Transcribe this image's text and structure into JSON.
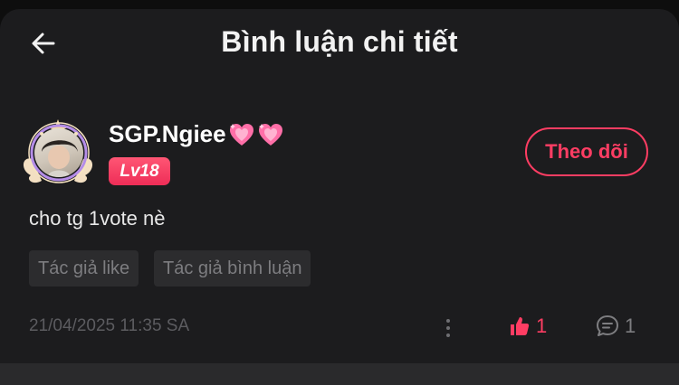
{
  "header": {
    "title": "Bình luận chi tiết",
    "back_icon": "arrow-left-icon"
  },
  "comment": {
    "user": {
      "name": "SGP.Ngiee",
      "name_suffix_icons": [
        "sparkling-heart-icon",
        "sparkling-heart-icon"
      ],
      "level": "Lv18",
      "avatar_icon": "avatar-with-winged-frame"
    },
    "follow_label": "Theo dõi",
    "text": "cho tg 1vote nè",
    "tags": [
      "Tác giả like",
      "Tác giả bình luận"
    ],
    "timestamp": "21/04/2025 11:35 SA",
    "likes": "1",
    "replies": "1"
  },
  "colors": {
    "accent": "#ff3d63",
    "background": "#1c1c1e",
    "tag_background": "#2c2c2e",
    "muted_text": "#7d7d80"
  }
}
